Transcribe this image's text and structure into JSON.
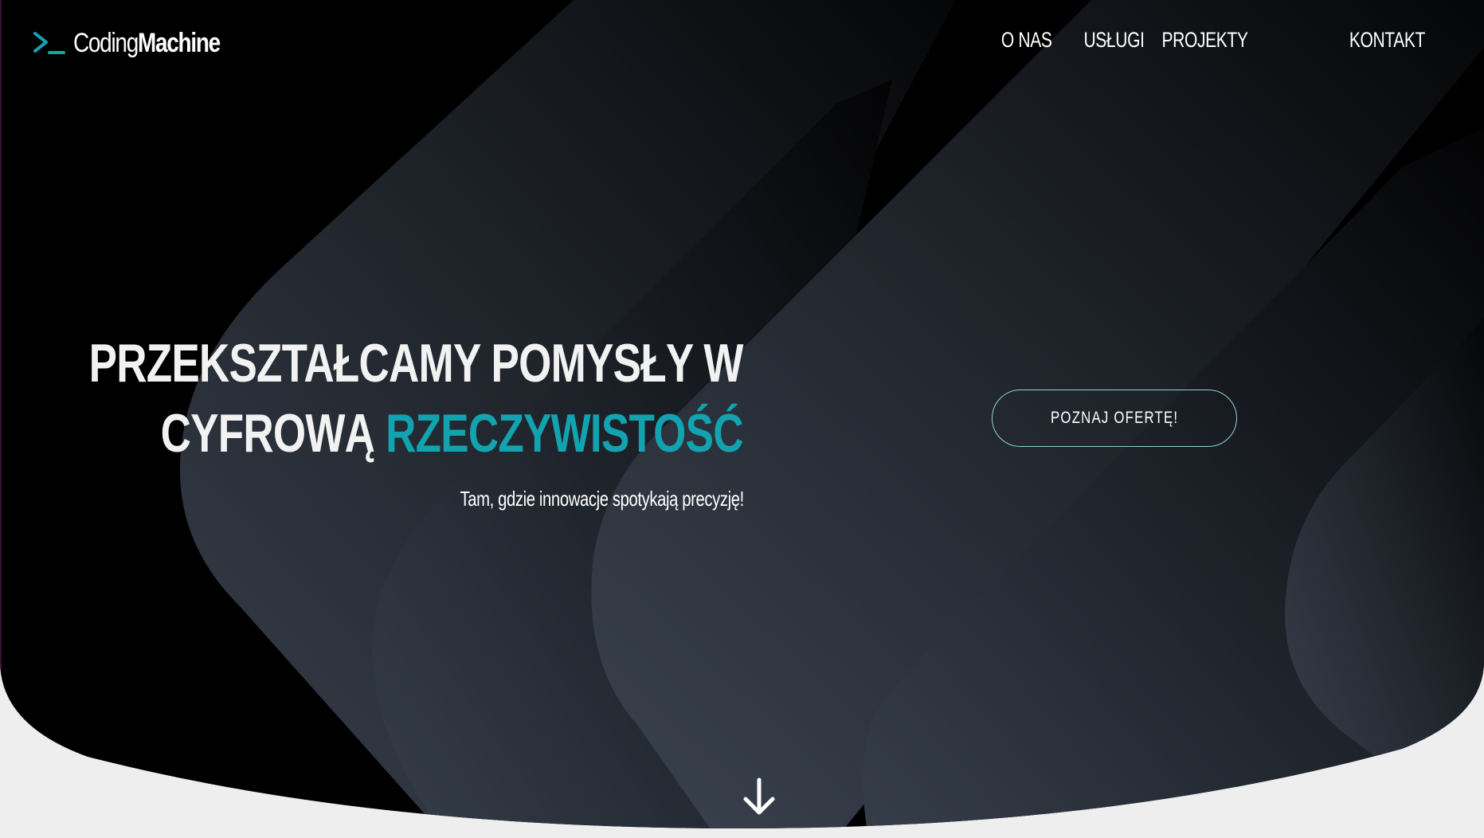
{
  "brand": {
    "prompt_icon": "terminal-prompt-icon",
    "name_light": "Coding",
    "name_bold": "Machine",
    "accent_color": "#13a3b0"
  },
  "nav": {
    "items": [
      {
        "label": "O NAS"
      },
      {
        "label": "USŁUGI"
      },
      {
        "label": "PROJEKTY"
      },
      {
        "label": "KONTAKT"
      }
    ]
  },
  "hero": {
    "headline_line1": "PRZEKSZTAŁCAMY POMYSŁY W",
    "headline_line2_plain": "CYFROWĄ",
    "headline_line2_accent": "RZECZYWISTOŚĆ",
    "tagline": "Tam, gdzie innowacje spotykają precyzję!",
    "cta_label": "POZNAJ OFERTĘ!",
    "scroll_icon": "arrow-down-icon"
  },
  "colors": {
    "background": "#000000",
    "page_bottom": "#eeeeee",
    "cta_border": "#8fd3d6",
    "text": "#f2f2f2"
  }
}
